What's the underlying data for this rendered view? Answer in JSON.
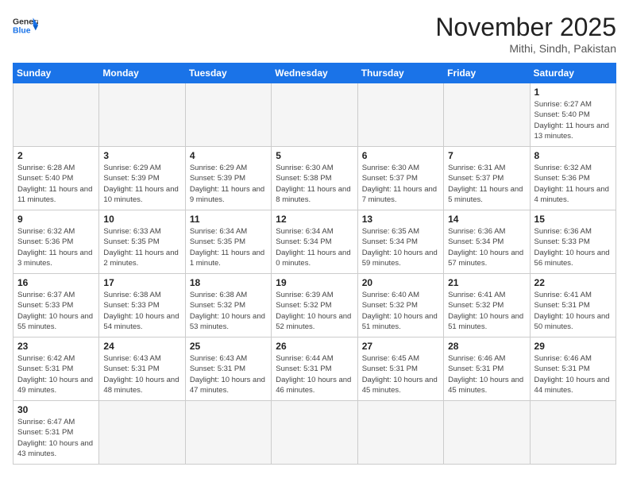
{
  "header": {
    "logo_general": "General",
    "logo_blue": "Blue",
    "month_title": "November 2025",
    "location": "Mithi, Sindh, Pakistan"
  },
  "weekdays": [
    "Sunday",
    "Monday",
    "Tuesday",
    "Wednesday",
    "Thursday",
    "Friday",
    "Saturday"
  ],
  "weeks": [
    [
      {
        "day": "",
        "sunrise": "",
        "sunset": "",
        "daylight": ""
      },
      {
        "day": "",
        "sunrise": "",
        "sunset": "",
        "daylight": ""
      },
      {
        "day": "",
        "sunrise": "",
        "sunset": "",
        "daylight": ""
      },
      {
        "day": "",
        "sunrise": "",
        "sunset": "",
        "daylight": ""
      },
      {
        "day": "",
        "sunrise": "",
        "sunset": "",
        "daylight": ""
      },
      {
        "day": "",
        "sunrise": "",
        "sunset": "",
        "daylight": ""
      },
      {
        "day": "1",
        "sunrise": "Sunrise: 6:27 AM",
        "sunset": "Sunset: 5:40 PM",
        "daylight": "Daylight: 11 hours and 13 minutes."
      }
    ],
    [
      {
        "day": "2",
        "sunrise": "Sunrise: 6:28 AM",
        "sunset": "Sunset: 5:40 PM",
        "daylight": "Daylight: 11 hours and 11 minutes."
      },
      {
        "day": "3",
        "sunrise": "Sunrise: 6:29 AM",
        "sunset": "Sunset: 5:39 PM",
        "daylight": "Daylight: 11 hours and 10 minutes."
      },
      {
        "day": "4",
        "sunrise": "Sunrise: 6:29 AM",
        "sunset": "Sunset: 5:39 PM",
        "daylight": "Daylight: 11 hours and 9 minutes."
      },
      {
        "day": "5",
        "sunrise": "Sunrise: 6:30 AM",
        "sunset": "Sunset: 5:38 PM",
        "daylight": "Daylight: 11 hours and 8 minutes."
      },
      {
        "day": "6",
        "sunrise": "Sunrise: 6:30 AM",
        "sunset": "Sunset: 5:37 PM",
        "daylight": "Daylight: 11 hours and 7 minutes."
      },
      {
        "day": "7",
        "sunrise": "Sunrise: 6:31 AM",
        "sunset": "Sunset: 5:37 PM",
        "daylight": "Daylight: 11 hours and 5 minutes."
      },
      {
        "day": "8",
        "sunrise": "Sunrise: 6:32 AM",
        "sunset": "Sunset: 5:36 PM",
        "daylight": "Daylight: 11 hours and 4 minutes."
      }
    ],
    [
      {
        "day": "9",
        "sunrise": "Sunrise: 6:32 AM",
        "sunset": "Sunset: 5:36 PM",
        "daylight": "Daylight: 11 hours and 3 minutes."
      },
      {
        "day": "10",
        "sunrise": "Sunrise: 6:33 AM",
        "sunset": "Sunset: 5:35 PM",
        "daylight": "Daylight: 11 hours and 2 minutes."
      },
      {
        "day": "11",
        "sunrise": "Sunrise: 6:34 AM",
        "sunset": "Sunset: 5:35 PM",
        "daylight": "Daylight: 11 hours and 1 minute."
      },
      {
        "day": "12",
        "sunrise": "Sunrise: 6:34 AM",
        "sunset": "Sunset: 5:34 PM",
        "daylight": "Daylight: 11 hours and 0 minutes."
      },
      {
        "day": "13",
        "sunrise": "Sunrise: 6:35 AM",
        "sunset": "Sunset: 5:34 PM",
        "daylight": "Daylight: 10 hours and 59 minutes."
      },
      {
        "day": "14",
        "sunrise": "Sunrise: 6:36 AM",
        "sunset": "Sunset: 5:34 PM",
        "daylight": "Daylight: 10 hours and 57 minutes."
      },
      {
        "day": "15",
        "sunrise": "Sunrise: 6:36 AM",
        "sunset": "Sunset: 5:33 PM",
        "daylight": "Daylight: 10 hours and 56 minutes."
      }
    ],
    [
      {
        "day": "16",
        "sunrise": "Sunrise: 6:37 AM",
        "sunset": "Sunset: 5:33 PM",
        "daylight": "Daylight: 10 hours and 55 minutes."
      },
      {
        "day": "17",
        "sunrise": "Sunrise: 6:38 AM",
        "sunset": "Sunset: 5:33 PM",
        "daylight": "Daylight: 10 hours and 54 minutes."
      },
      {
        "day": "18",
        "sunrise": "Sunrise: 6:38 AM",
        "sunset": "Sunset: 5:32 PM",
        "daylight": "Daylight: 10 hours and 53 minutes."
      },
      {
        "day": "19",
        "sunrise": "Sunrise: 6:39 AM",
        "sunset": "Sunset: 5:32 PM",
        "daylight": "Daylight: 10 hours and 52 minutes."
      },
      {
        "day": "20",
        "sunrise": "Sunrise: 6:40 AM",
        "sunset": "Sunset: 5:32 PM",
        "daylight": "Daylight: 10 hours and 51 minutes."
      },
      {
        "day": "21",
        "sunrise": "Sunrise: 6:41 AM",
        "sunset": "Sunset: 5:32 PM",
        "daylight": "Daylight: 10 hours and 51 minutes."
      },
      {
        "day": "22",
        "sunrise": "Sunrise: 6:41 AM",
        "sunset": "Sunset: 5:31 PM",
        "daylight": "Daylight: 10 hours and 50 minutes."
      }
    ],
    [
      {
        "day": "23",
        "sunrise": "Sunrise: 6:42 AM",
        "sunset": "Sunset: 5:31 PM",
        "daylight": "Daylight: 10 hours and 49 minutes."
      },
      {
        "day": "24",
        "sunrise": "Sunrise: 6:43 AM",
        "sunset": "Sunset: 5:31 PM",
        "daylight": "Daylight: 10 hours and 48 minutes."
      },
      {
        "day": "25",
        "sunrise": "Sunrise: 6:43 AM",
        "sunset": "Sunset: 5:31 PM",
        "daylight": "Daylight: 10 hours and 47 minutes."
      },
      {
        "day": "26",
        "sunrise": "Sunrise: 6:44 AM",
        "sunset": "Sunset: 5:31 PM",
        "daylight": "Daylight: 10 hours and 46 minutes."
      },
      {
        "day": "27",
        "sunrise": "Sunrise: 6:45 AM",
        "sunset": "Sunset: 5:31 PM",
        "daylight": "Daylight: 10 hours and 45 minutes."
      },
      {
        "day": "28",
        "sunrise": "Sunrise: 6:46 AM",
        "sunset": "Sunset: 5:31 PM",
        "daylight": "Daylight: 10 hours and 45 minutes."
      },
      {
        "day": "29",
        "sunrise": "Sunrise: 6:46 AM",
        "sunset": "Sunset: 5:31 PM",
        "daylight": "Daylight: 10 hours and 44 minutes."
      }
    ],
    [
      {
        "day": "30",
        "sunrise": "Sunrise: 6:47 AM",
        "sunset": "Sunset: 5:31 PM",
        "daylight": "Daylight: 10 hours and 43 minutes."
      },
      {
        "day": "",
        "sunrise": "",
        "sunset": "",
        "daylight": ""
      },
      {
        "day": "",
        "sunrise": "",
        "sunset": "",
        "daylight": ""
      },
      {
        "day": "",
        "sunrise": "",
        "sunset": "",
        "daylight": ""
      },
      {
        "day": "",
        "sunrise": "",
        "sunset": "",
        "daylight": ""
      },
      {
        "day": "",
        "sunrise": "",
        "sunset": "",
        "daylight": ""
      },
      {
        "day": "",
        "sunrise": "",
        "sunset": "",
        "daylight": ""
      }
    ]
  ]
}
